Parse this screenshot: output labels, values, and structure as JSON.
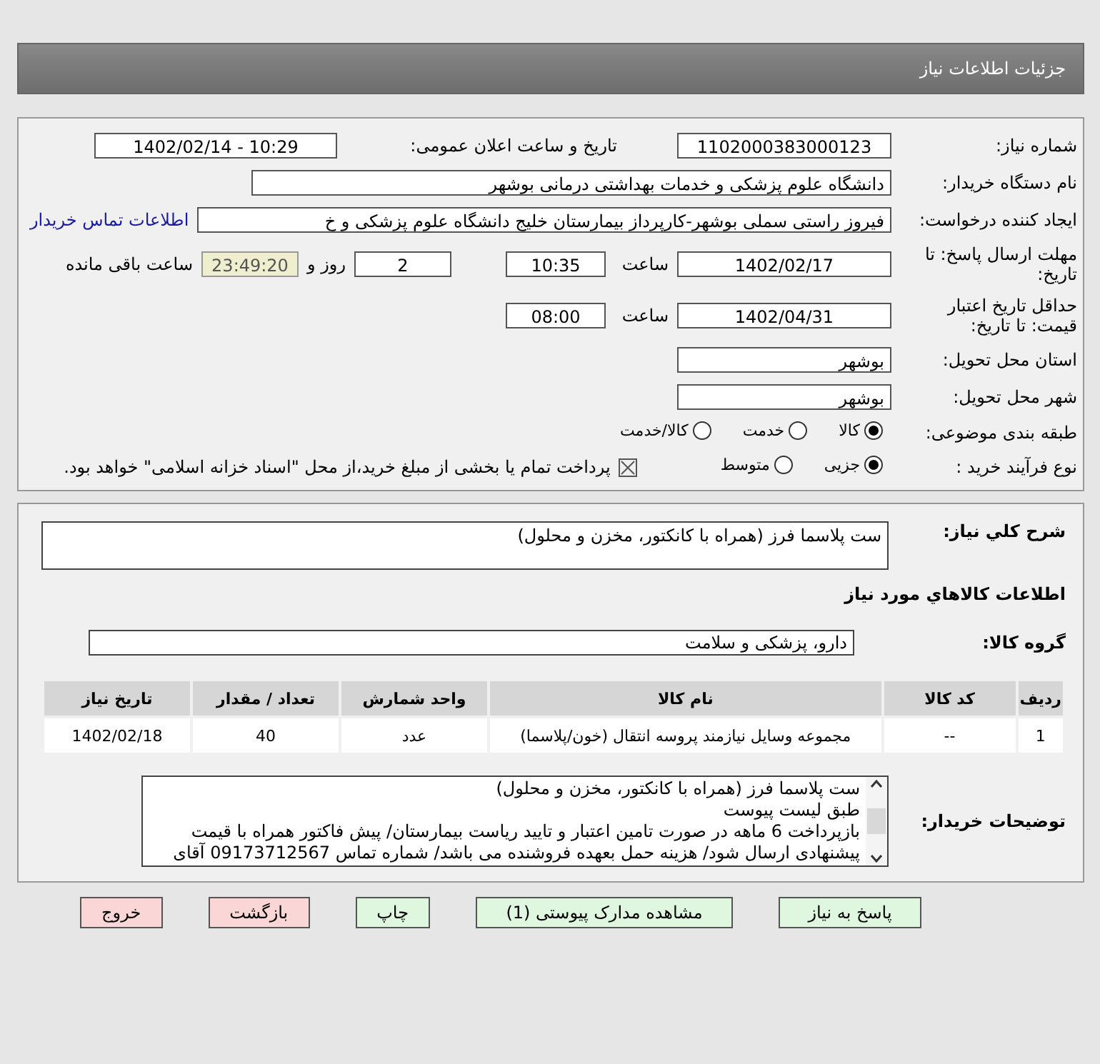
{
  "title": "جزئیات اطلاعات نیاز",
  "info": {
    "need_number": {
      "label": "شماره نیاز:",
      "value": "1102000383000123"
    },
    "announce": {
      "label": "تاریخ و ساعت اعلان عمومی:",
      "value": "1402/02/14 - 10:29"
    },
    "buyer": {
      "label": "نام دستگاه خریدار:",
      "value": "دانشگاه علوم پزشکی و خدمات بهداشتی درمانی بوشهر"
    },
    "requester": {
      "label": "ایجاد کننده درخواست:",
      "value": "فیروز راستی سملی بوشهر-کارپرداز بیمارستان خلیج دانشگاه علوم پزشکی و خ",
      "link": "اطلاعات تماس خریدار"
    },
    "deadline": {
      "label": "مهلت ارسال پاسخ: تا تاریخ:",
      "date": "1402/02/17",
      "time_label": "ساعت",
      "time": "10:35",
      "days": "2",
      "days_label": "روز و",
      "remaining": "23:49:20",
      "remaining_label": "ساعت باقی مانده"
    },
    "validity": {
      "label": "حداقل تاریخ اعتبار قیمت: تا تاریخ:",
      "date": "1402/04/31",
      "time_label": "ساعت",
      "time": "08:00"
    },
    "province": {
      "label": "استان محل تحویل:",
      "value": "بوشهر"
    },
    "city": {
      "label": "شهر محل تحویل:",
      "value": "بوشهر"
    },
    "category": {
      "label": "طبقه بندی موضوعی:",
      "options": [
        {
          "label": "کالا",
          "selected": true
        },
        {
          "label": "خدمت",
          "selected": false
        },
        {
          "label": "کالا/خدمت",
          "selected": false
        }
      ]
    },
    "process": {
      "label": "نوع فرآیند خرید :",
      "options": [
        {
          "label": "جزیی",
          "selected": true
        },
        {
          "label": "متوسط",
          "selected": false
        }
      ],
      "payment": {
        "checked": true,
        "text": "پرداخت تمام یا بخشی از مبلغ خرید،از محل \"اسناد خزانه اسلامی\" خواهد بود."
      }
    }
  },
  "goods": {
    "summary": {
      "label": "شرح کلي نياز:",
      "value": "ست پلاسما فرز (همراه با کانکتور، مخزن و محلول)"
    },
    "section_title": "اطلاعات کالاهاي مورد نياز",
    "group": {
      "label": "گروه کالا:",
      "value": "دارو، پزشکی و سلامت"
    },
    "table": {
      "columns": [
        "ردیف",
        "کد کالا",
        "نام کالا",
        "واحد شمارش",
        "تعداد / مقدار",
        "تاریخ نیاز"
      ],
      "rows": [
        [
          "1",
          "--",
          "مجموعه وسایل نیازمند پروسه انتقال (خون/پلاسما)",
          "عدد",
          "40",
          "1402/02/18"
        ]
      ]
    },
    "description": {
      "label": "توضیحات خریدار:",
      "lines": [
        "ست پلاسما فرز (همراه با کانکتور، مخزن و محلول)",
        "طبق لیست پیوست",
        "بازپرداخت 6 ماهه در صورت تامین اعتبار و تایید ریاست بیمارستان/ پیش فاکتور همراه با قیمت",
        "پیشنهادی ارسال شود/ هزینه حمل بعهده فروشنده می باشد/ شماره تماس 09173712567 آقای"
      ]
    }
  },
  "buttons": [
    {
      "label": "پاسخ به نیاز",
      "kind": "action"
    },
    {
      "label": "مشاهده مدارک پیوستی (1)",
      "kind": "action"
    },
    {
      "label": "چاپ",
      "kind": "action"
    },
    {
      "label": "بازگشت",
      "kind": "exit"
    },
    {
      "label": "خروج",
      "kind": "exit"
    }
  ]
}
